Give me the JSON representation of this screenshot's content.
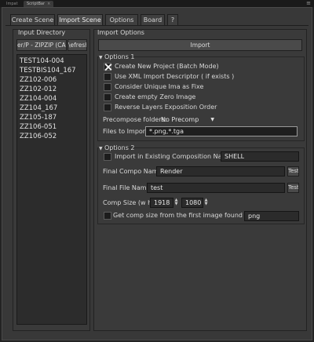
{
  "panel_tabs": [
    {
      "label": "Impat",
      "active": false
    },
    {
      "label": "ScriptBar",
      "active": true
    }
  ],
  "panel_menu_icon": "menu-icon",
  "tabs": [
    "Create Scene",
    "Import Scene",
    "Options",
    "Board",
    "?"
  ],
  "active_tab": "Import Scene",
  "input_directory": {
    "title": "Input Directory",
    "path_button": "er/P - ZIPZIP (CAA",
    "refresh_button": "\\efresh",
    "items": [
      "TEST104-004",
      "TESTBIS104_167",
      "ZZ102-006",
      "ZZ102-012",
      "ZZ104-004",
      "ZZ104_167",
      "ZZ105-187",
      "ZZ106-051",
      "ZZ106-052"
    ]
  },
  "import_options": {
    "title": "Import Options",
    "import_button": "Import",
    "options1": {
      "title": "Options 1",
      "checkboxes": [
        {
          "label": "Create New Project (Batch Mode)",
          "checked": true
        },
        {
          "label": "Use XML Import Descriptor ( if exists )",
          "checked": false
        },
        {
          "label": "Consider Unique Ima as Fixe",
          "checked": false
        },
        {
          "label": "Create empty Zero  Image",
          "checked": false
        },
        {
          "label": "Reverse Layers Exposition Order",
          "checked": false
        }
      ],
      "precompose_label": "Precompose folders:",
      "precompose_value": "No Precomp",
      "files_label": "Files to Import",
      "files_value": "*.png,*.tga"
    },
    "options2": {
      "title": "Options 2",
      "existing_comp_label": "Import in Existing Composition Named:",
      "existing_comp_checked": false,
      "existing_comp_value": "SHELL",
      "final_compo_label": "Final Compo Name :",
      "final_compo_value": "Render",
      "final_compo_test": "Test",
      "final_file_label": "Final File Name :",
      "final_file_value": "test",
      "final_file_test": "Test",
      "comp_size_label": "Comp Size (w h) :",
      "comp_width": "1918",
      "comp_height": "1080",
      "comp_size_from_image_label": "Get comp size from the first image found with ext:",
      "comp_size_from_image_checked": false,
      "comp_size_ext": "png"
    }
  }
}
